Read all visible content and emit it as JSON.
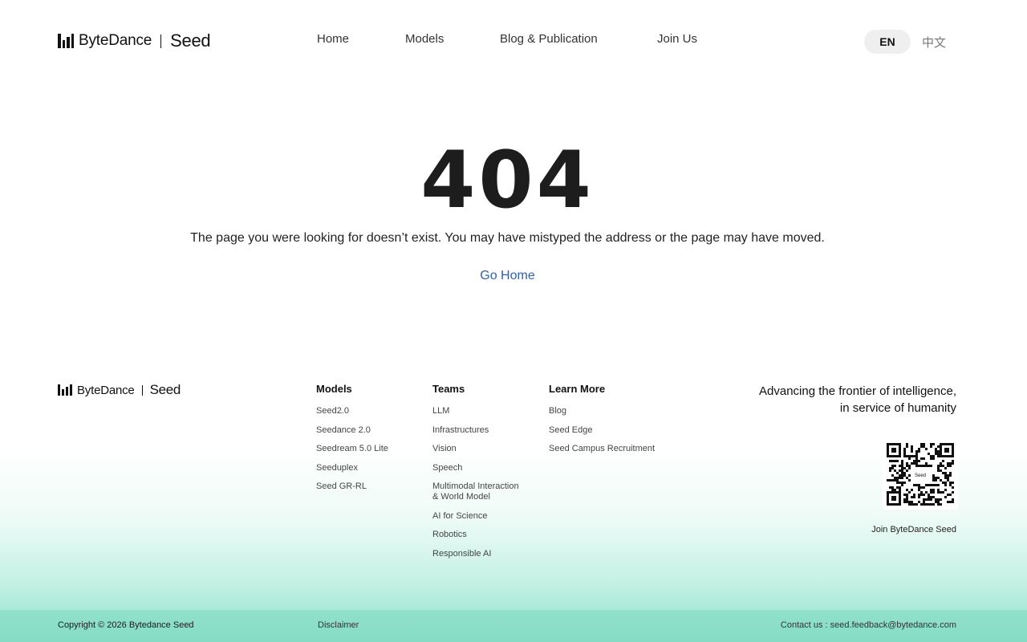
{
  "header": {
    "logo": {
      "brand": "ByteDance",
      "product": "Seed"
    },
    "nav": [
      {
        "label": "Home"
      },
      {
        "label": "Models"
      },
      {
        "label": "Blog & Publication"
      },
      {
        "label": "Join Us"
      }
    ],
    "lang": {
      "active": "EN",
      "alt": "中文"
    }
  },
  "main": {
    "code": "404",
    "message": "The page you were looking for doesn’t exist. You may have mistyped the address or the page may have moved.",
    "go_home": "Go Home"
  },
  "footer": {
    "logo": {
      "brand": "ByteDance",
      "product": "Seed"
    },
    "columns": [
      {
        "title": "Models",
        "links": [
          "Seed2.0",
          "Seedance 2.0",
          "Seedream 5.0 Lite",
          "Seeduplex",
          "Seed GR-RL"
        ]
      },
      {
        "title": "Teams",
        "links": [
          "LLM",
          "Infrastructures",
          "Vision",
          "Speech",
          "Multimodal Interaction\n& World Model",
          "AI for Science",
          "Robotics",
          "Responsible AI"
        ]
      },
      {
        "title": "Learn More",
        "links": [
          "Blog",
          "Seed Edge",
          "Seed Campus Recruitment"
        ]
      }
    ],
    "tagline_line1": "Advancing the frontier of intelligence,",
    "tagline_line2": "in service of humanity",
    "qr_center_text": "Seed",
    "qr_label": "Join ByteDance Seed",
    "copyright": "Copyright © 2026 Bytedance Seed",
    "disclaimer": "Disclaimer",
    "contact": "Contact us : seed.feedback@bytedance.com"
  },
  "colors": {
    "link": "#2f62ad",
    "footer_gradient_end": "#8de1cb",
    "lang_pill": "#efefef"
  }
}
